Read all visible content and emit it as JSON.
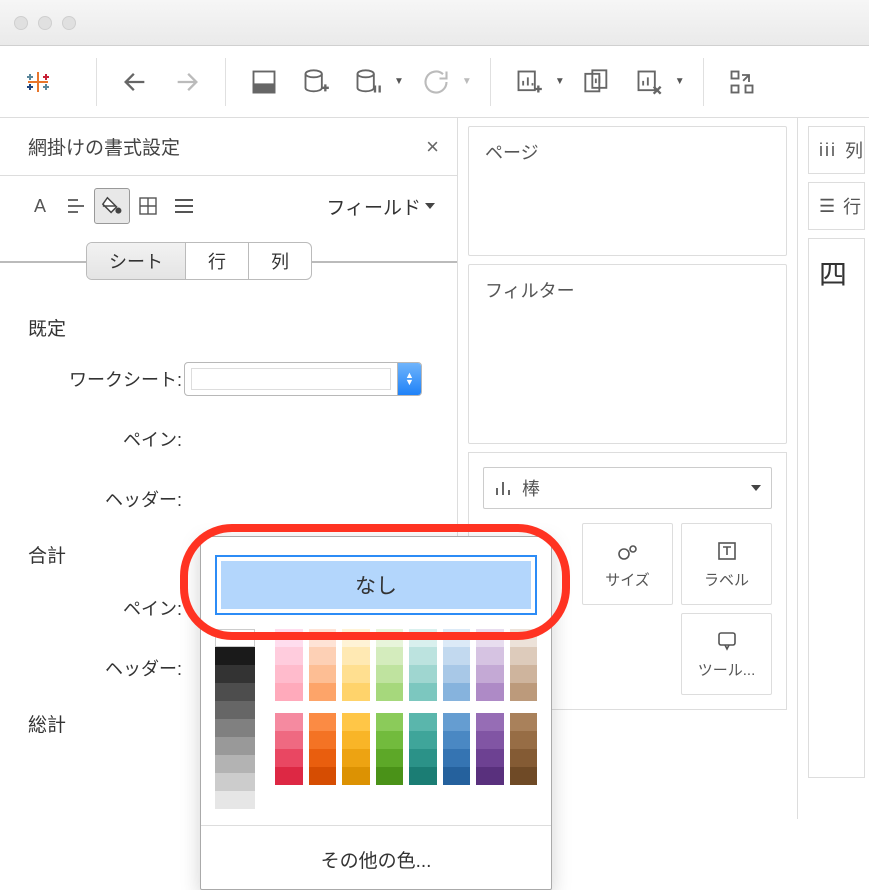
{
  "fmt": {
    "title": "網掛けの書式設定",
    "close": "×",
    "field_label": "フィールド",
    "tabs": {
      "sheet": "シート",
      "row": "行",
      "col": "列"
    },
    "sections": {
      "default": "既定",
      "total": "合計",
      "grand": "総計"
    },
    "rows": {
      "worksheet": "ワークシート:",
      "pane": "ペイン:",
      "header": "ヘッダー:"
    }
  },
  "shelves": {
    "pages": "ページ",
    "filters": "フィルター",
    "columns": "列",
    "rows_shelf": "行"
  },
  "marks": {
    "type": "棒",
    "size": "サイズ",
    "label": "ラベル",
    "tooltip": "ツール..."
  },
  "popup": {
    "none": "なし",
    "more": "その他の色..."
  },
  "view": {
    "title": "四"
  },
  "column_prefix": "iii",
  "row_prefix": ":☰"
}
